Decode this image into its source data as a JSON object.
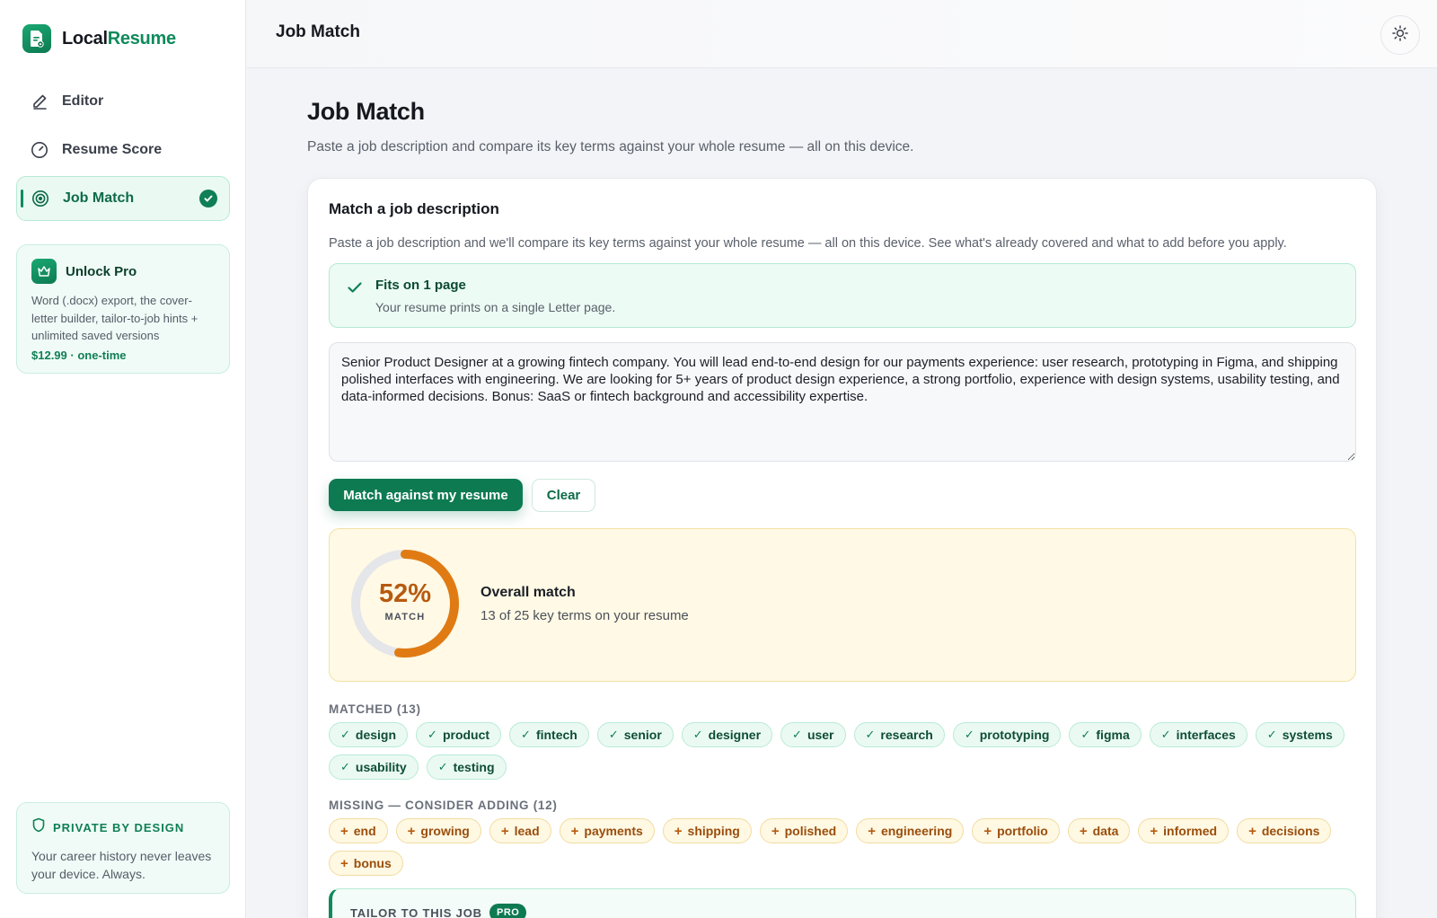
{
  "brand": {
    "name_prefix": "Local",
    "name_accent": "Resume"
  },
  "sidebar": {
    "nav": [
      {
        "label": "Editor",
        "icon": "pencil-icon",
        "active": false
      },
      {
        "label": "Resume Score",
        "icon": "gauge-icon",
        "active": false
      },
      {
        "label": "Job Match",
        "icon": "target-icon",
        "active": true
      }
    ],
    "pro": {
      "title": "Unlock Pro",
      "description": "Word (.docx) export, the cover-letter builder, tailor-to-job hints + unlimited saved versions",
      "price": "$12.99 · one-time"
    },
    "privacy": {
      "title": "PRIVATE BY DESIGN",
      "description": "Your career history never leaves your device. Always."
    }
  },
  "topbar": {
    "title": "Job Match"
  },
  "main": {
    "title": "Job Match",
    "subtitle": "Paste a job description and compare its key terms against your whole resume — all on this device.",
    "card": {
      "title": "Match a job description",
      "description": "Paste a job description and we'll compare its key terms against your whole resume — all on this device. See what's already covered and what to add before you apply.",
      "fit": {
        "title": "Fits on 1 page",
        "subtitle": "Your resume prints on a single Letter page."
      },
      "job_description": "Senior Product Designer at a growing fintech company. You will lead end-to-end design for our payments experience: user research, prototyping in Figma, and shipping polished interfaces with engineering. We are looking for 5+ years of product design experience, a strong portfolio, experience with design systems, usability testing, and data-informed decisions. Bonus: SaaS or fintech background and accessibility expertise.",
      "match_button": "Match against my resume",
      "clear_button": "Clear",
      "score": {
        "percent": 52,
        "percent_label": "52%",
        "ring_label": "MATCH",
        "title": "Overall match",
        "subtitle": "13 of 25 key terms on your resume",
        "ring_color": "#e07b13",
        "track_color": "#e5e6ea"
      },
      "matched_label": "MATCHED (13)",
      "matched": [
        "design",
        "product",
        "fintech",
        "senior",
        "designer",
        "user",
        "research",
        "prototyping",
        "figma",
        "interfaces",
        "systems",
        "usability",
        "testing"
      ],
      "missing_label": "MISSING — CONSIDER ADDING (12)",
      "missing": [
        "end",
        "growing",
        "lead",
        "payments",
        "shipping",
        "polished",
        "engineering",
        "portfolio",
        "data",
        "informed",
        "decisions",
        "bonus"
      ],
      "tailor": {
        "title": "TAILOR TO THIS JOB",
        "badge": "PRO"
      }
    }
  },
  "colors": {
    "accent": "#0e7a52",
    "warning": "#b75a0f"
  }
}
